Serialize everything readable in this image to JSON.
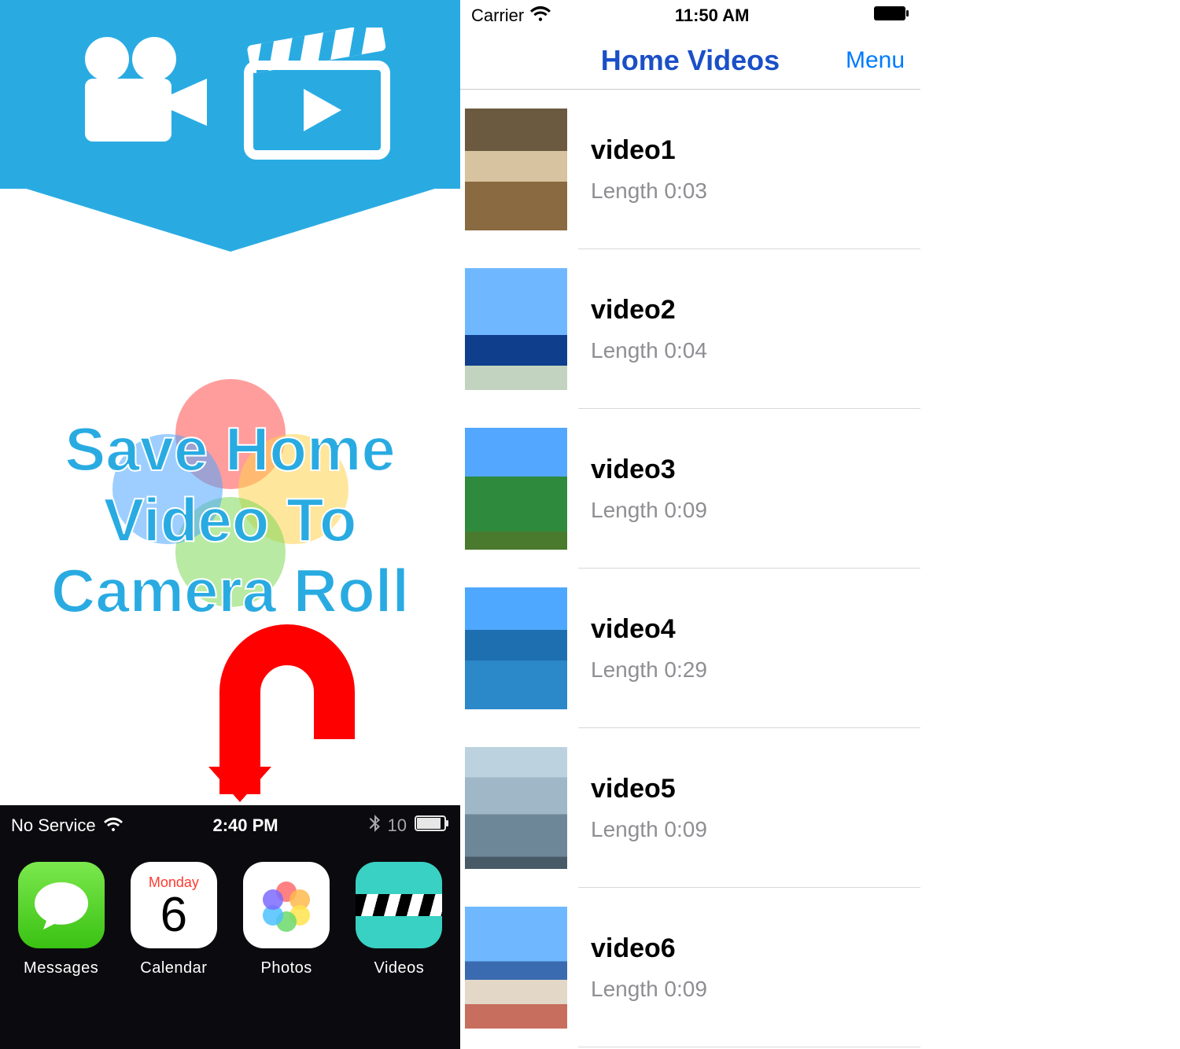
{
  "promo": {
    "line1": "Save Home",
    "line2": "Video To",
    "line3": "Camera Roll"
  },
  "dock": {
    "statusbar": {
      "carrier": "No Service",
      "time": "2:40 PM",
      "battery": "10"
    },
    "items": [
      {
        "label": "Messages"
      },
      {
        "label": "Calendar",
        "day": "Monday",
        "num": "6"
      },
      {
        "label": "Photos"
      },
      {
        "label": "Videos"
      }
    ]
  },
  "app": {
    "statusbar": {
      "carrier": "Carrier",
      "time": "11:50 AM"
    },
    "nav": {
      "title": "Home Videos",
      "menu": "Menu"
    },
    "videos": [
      {
        "title": "video1",
        "length": "Length 0:03"
      },
      {
        "title": "video2",
        "length": "Length 0:04"
      },
      {
        "title": "video3",
        "length": "Length 0:09"
      },
      {
        "title": "video4",
        "length": "Length 0:29"
      },
      {
        "title": "video5",
        "length": "Length 0:09"
      },
      {
        "title": "video6",
        "length": "Length 0:09"
      }
    ]
  }
}
